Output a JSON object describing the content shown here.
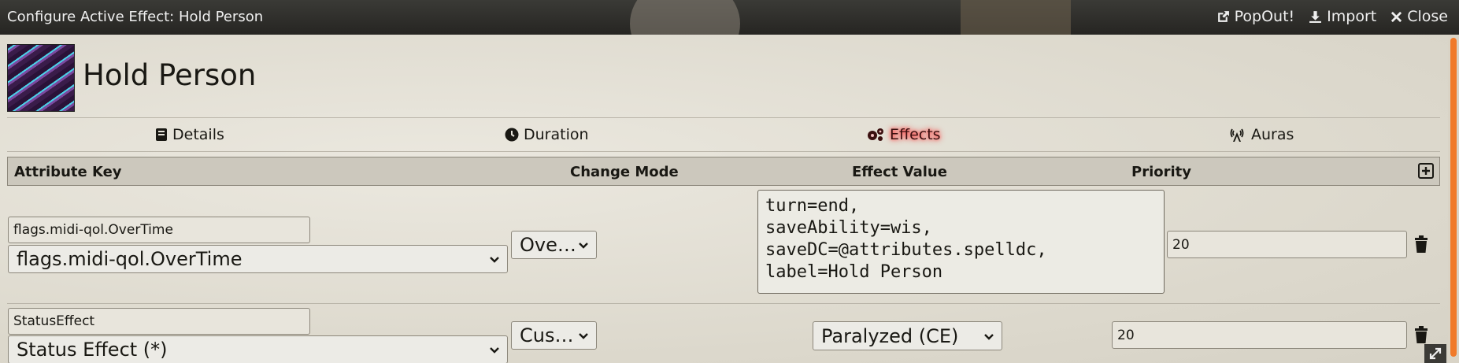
{
  "window": {
    "title": "Configure Active Effect: Hold Person",
    "actions": [
      {
        "label": "PopOut!",
        "icon": "external-link-icon"
      },
      {
        "label": "Import",
        "icon": "download-icon"
      },
      {
        "label": "Close",
        "icon": "close-icon"
      }
    ]
  },
  "effect": {
    "name": "Hold Person"
  },
  "tabs": [
    {
      "label": "Details",
      "icon": "book-icon",
      "active": false
    },
    {
      "label": "Duration",
      "icon": "clock-icon",
      "active": false
    },
    {
      "label": "Effects",
      "icon": "cogs-icon",
      "active": true
    },
    {
      "label": "Auras",
      "icon": "broadcast-tower-icon",
      "active": false
    }
  ],
  "table": {
    "columns": [
      "Attribute Key",
      "Change Mode",
      "Effect Value",
      "Priority"
    ],
    "rows": [
      {
        "key_text": "flags.midi-qol.OverTime",
        "key_select": "flags.midi-qol.OverTime",
        "mode": "Ove…",
        "value_text": "turn=end,\nsaveAbility=wis,\nsaveDC=@attributes.spelldc,\nlabel=Hold Person",
        "priority": "20"
      },
      {
        "key_text": "StatusEffect",
        "key_select": "Status Effect (*)",
        "mode": "Cus…",
        "value_select": "Paralyzed (CE)",
        "priority": "20"
      }
    ]
  },
  "colors": {
    "accent_scroll": "#f07a2a",
    "active_tab_glow": "#ff2020"
  }
}
